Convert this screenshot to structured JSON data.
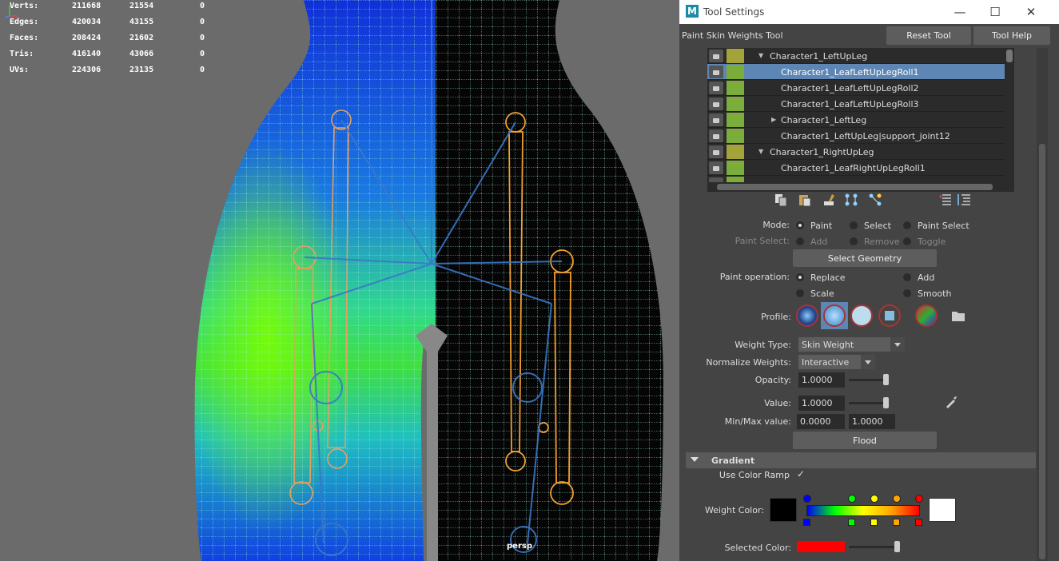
{
  "viewport": {
    "stats": [
      {
        "label": "Verts:",
        "a": "211668",
        "b": "21554",
        "c": "0"
      },
      {
        "label": "Edges:",
        "a": "420034",
        "b": "43155",
        "c": "0"
      },
      {
        "label": "Faces:",
        "a": "208424",
        "b": "21602",
        "c": "0"
      },
      {
        "label": "Tris:",
        "a": "416140",
        "b": "43066",
        "c": "0"
      },
      {
        "label": "UVs:",
        "a": "224306",
        "b": "23135",
        "c": "0"
      }
    ],
    "camera": "persp"
  },
  "window": {
    "title": "Tool Settings",
    "logo": "M",
    "minimize": "—",
    "maximize": "☐",
    "close": "✕"
  },
  "tool": {
    "name": "Paint Skin Weights Tool",
    "reset": "Reset Tool",
    "help": "Tool Help"
  },
  "influences": [
    {
      "name": "Character1_LeftUpLeg",
      "color": "#a3a33a",
      "expander": "expanded",
      "selected": false
    },
    {
      "name": "Character1_LeafLeftUpLegRoll1",
      "color": "#7cac3a",
      "expander": "none",
      "selected": true
    },
    {
      "name": "Character1_LeafLeftUpLegRoll2",
      "color": "#7cac3a",
      "expander": "none",
      "selected": false
    },
    {
      "name": "Character1_LeafLeftUpLegRoll3",
      "color": "#7cac3a",
      "expander": "none",
      "selected": false
    },
    {
      "name": "Character1_LeftLeg",
      "color": "#7cac3a",
      "expander": "collapsed",
      "selected": false
    },
    {
      "name": "Character1_LeftUpLeg|support_joint12",
      "color": "#7cac3a",
      "expander": "none",
      "selected": false
    },
    {
      "name": "Character1_RightUpLeg",
      "color": "#a3a33a",
      "expander": "expanded",
      "selected": false
    },
    {
      "name": "Character1_LeafRightUpLegRoll1",
      "color": "#7cac3a",
      "expander": "none",
      "selected": false
    },
    {
      "name": "",
      "color": "#7cac3a",
      "expander": "none",
      "selected": false
    }
  ],
  "mode": {
    "label": "Mode:",
    "options": [
      "Paint",
      "Select",
      "Paint Select"
    ],
    "selected": "Paint"
  },
  "paint_select": {
    "label": "Paint Select:",
    "options": [
      "Add",
      "Remove",
      "Toggle"
    ]
  },
  "select_geometry": "Select Geometry",
  "paint_op": {
    "label": "Paint operation:",
    "options": [
      "Replace",
      "Add",
      "Scale",
      "Smooth"
    ],
    "selected": "Replace"
  },
  "profile": {
    "label": "Profile:"
  },
  "weight_type": {
    "label": "Weight Type:",
    "value": "Skin Weight"
  },
  "normalize": {
    "label": "Normalize Weights:",
    "value": "Interactive"
  },
  "opacity": {
    "label": "Opacity:",
    "value": "1.0000",
    "level": 1.0
  },
  "value": {
    "label": "Value:",
    "value": "1.0000",
    "level": 1.0
  },
  "minmax": {
    "label": "Min/Max value:",
    "min": "0.0000",
    "max": "1.0000"
  },
  "flood": "Flood",
  "gradient": {
    "title": "Gradient",
    "use_ramp_label": "Use Color Ramp",
    "use_ramp": true,
    "weight_color_label": "Weight Color:",
    "selected_color_label": "Selected Color:",
    "selected_color": "#ff0000",
    "ramp_stops": [
      "#0000ff",
      "#00ff00",
      "#ffff00",
      "#ffa500",
      "#ff0000"
    ]
  },
  "colors": {
    "accent": "#5d86b4",
    "bg": "#444444"
  }
}
